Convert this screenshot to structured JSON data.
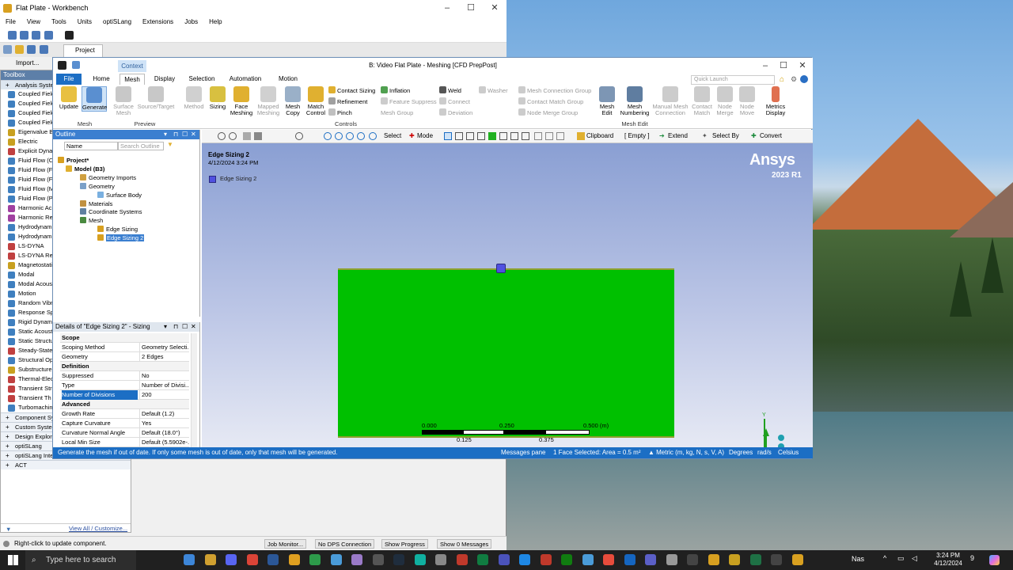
{
  "workbench": {
    "title": "Flat Plate - Workbench",
    "menu": [
      "File",
      "View",
      "Tools",
      "Units",
      "optiSLang",
      "Extensions",
      "Jobs",
      "Help"
    ],
    "import_label": "Import...",
    "project_tab": "Project",
    "toolbox_title": "Toolbox",
    "analysis_group": "Analysis Systems",
    "toolbox_items": [
      {
        "label": "Coupled Field",
        "color": "#3f7fbf"
      },
      {
        "label": "Coupled Field",
        "color": "#3f7fbf"
      },
      {
        "label": "Coupled Field",
        "color": "#3f7fbf"
      },
      {
        "label": "Coupled Field",
        "color": "#3f7fbf"
      },
      {
        "label": "Eigenvalue B",
        "color": "#c8a020"
      },
      {
        "label": "Electric",
        "color": "#c8a020"
      },
      {
        "label": "Explicit Dyna",
        "color": "#c04040"
      },
      {
        "label": "Fluid Flow (C",
        "color": "#3f7fbf"
      },
      {
        "label": "Fluid Flow (F",
        "color": "#3f7fbf"
      },
      {
        "label": "Fluid Flow (F",
        "color": "#3f7fbf"
      },
      {
        "label": "Fluid Flow (M",
        "color": "#3f7fbf"
      },
      {
        "label": "Fluid Flow (P",
        "color": "#3f7fbf"
      },
      {
        "label": "Harmonic Ac",
        "color": "#a040a0"
      },
      {
        "label": "Harmonic Re",
        "color": "#a040a0"
      },
      {
        "label": "Hydrodynam",
        "color": "#3f7fbf"
      },
      {
        "label": "Hydrodynam",
        "color": "#3f7fbf"
      },
      {
        "label": "LS-DYNA",
        "color": "#c04040"
      },
      {
        "label": "LS-DYNA Res",
        "color": "#c04040"
      },
      {
        "label": "Magnetostati",
        "color": "#c8a020"
      },
      {
        "label": "Modal",
        "color": "#3f7fbf"
      },
      {
        "label": "Modal Acous",
        "color": "#3f7fbf"
      },
      {
        "label": "Motion",
        "color": "#3f7fbf"
      },
      {
        "label": "Random Vibr",
        "color": "#3f7fbf"
      },
      {
        "label": "Response Sp",
        "color": "#3f7fbf"
      },
      {
        "label": "Rigid Dynam",
        "color": "#3f7fbf"
      },
      {
        "label": "Static Acoust",
        "color": "#3f7fbf"
      },
      {
        "label": "Static Structu",
        "color": "#3f7fbf"
      },
      {
        "label": "Steady-State",
        "color": "#c04040"
      },
      {
        "label": "Structural Op",
        "color": "#3f7fbf"
      },
      {
        "label": "Substructure",
        "color": "#c8a020"
      },
      {
        "label": "Thermal-Elec",
        "color": "#c04040"
      },
      {
        "label": "Transient Str",
        "color": "#c04040"
      },
      {
        "label": "Transient Th",
        "color": "#c04040"
      },
      {
        "label": "Turbomachin",
        "color": "#3f7fbf"
      }
    ],
    "toolbox_groups": [
      "Component Sy",
      "Custom Syste",
      "Design Explor",
      "optiSLang",
      "optiSLang Integrations",
      "ACT"
    ],
    "view_all": "View All / Customize...",
    "status": "Right-click to update component.",
    "status_buttons": [
      "Job Monitor...",
      "No DPS Connection",
      "Show Progress",
      "Show 0 Messages"
    ]
  },
  "mechanical": {
    "title": "B: Video Flat Plate - Meshing [CFD PrepPost]",
    "context_tab": "Context",
    "tabs": [
      "File",
      "Home",
      "Mesh",
      "Display",
      "Selection",
      "Automation",
      "Motion"
    ],
    "quick_launch": "Quick Launch",
    "ribbon": {
      "update": "Update",
      "generate": "Generate",
      "surface_mesh": "Surface Mesh",
      "source_target": "Source/Target",
      "method": "Method",
      "sizing": "Sizing",
      "face_meshing": "Face Meshing",
      "mapped_meshing": "Mapped Meshing",
      "mesh_copy": "Mesh Copy",
      "match_control": "Match Control",
      "contact_sizing": "Contact Sizing",
      "refinement": "Refinement",
      "pinch": "Pinch",
      "inflation": "Inflation",
      "feature_suppress": "Feature Suppress",
      "mesh_group": "Mesh Group",
      "weld": "Weld",
      "connect": "Connect",
      "deviation": "Deviation",
      "washer": "Washer",
      "mesh_connection_group": "Mesh Connection Group",
      "contact_match_group": "Contact Match Group",
      "node_merge_group": "Node Merge Group",
      "mesh_edit": "Mesh Edit",
      "mesh_numbering": "Mesh Numbering",
      "manual_mesh_connection": "Manual Mesh Connection",
      "contact_match": "Contact Match",
      "node_merge": "Node Merge",
      "node_move": "Node Move",
      "metrics_display": "Metrics Display",
      "group_mesh": "Mesh",
      "group_preview": "Preview",
      "group_controls": "Controls",
      "group_mesh_edit": "Mesh Edit"
    },
    "viewbar": {
      "select": "Select",
      "mode": "Mode",
      "clipboard": "Clipboard",
      "empty": "[ Empty ]",
      "extend": "Extend",
      "select_by": "Select By",
      "convert": "Convert"
    },
    "outline": {
      "title": "Outline",
      "name_label": "Name",
      "search_placeholder": "Search Outline",
      "tree": [
        "Project*",
        "Model (B3)",
        "Geometry Imports",
        "Geometry",
        "Surface Body",
        "Materials",
        "Coordinate Systems",
        "Mesh",
        "Edge Sizing",
        "Edge Sizing 2"
      ]
    },
    "details": {
      "title": "Details of \"Edge Sizing 2\" - Sizing",
      "rows": [
        {
          "k": "Scope",
          "v": "",
          "head": true
        },
        {
          "k": "Scoping Method",
          "v": "Geometry Selecti..."
        },
        {
          "k": "Geometry",
          "v": "2 Edges"
        },
        {
          "k": "Definition",
          "v": "",
          "head": true
        },
        {
          "k": "Suppressed",
          "v": "No"
        },
        {
          "k": "Type",
          "v": "Number of Divisi..."
        },
        {
          "k": "Number of Divisions",
          "v": "200",
          "highlight": true
        },
        {
          "k": "Advanced",
          "v": "",
          "head": true
        },
        {
          "k": "Growth Rate",
          "v": "Default (1.2)"
        },
        {
          "k": "Capture Curvature",
          "v": "Yes"
        },
        {
          "k": "Curvature Normal Angle",
          "v": "Default (18.0°)"
        },
        {
          "k": "Local Min Size",
          "v": "Default (5.5902e-..."
        }
      ]
    },
    "viewport": {
      "label_title": "Edge Sizing 2",
      "label_date": "4/12/2024 3:24 PM",
      "legend": "Edge Sizing 2",
      "brand": "Ansys",
      "version": "2023 R1",
      "scale_top": [
        "0.000",
        "0.250",
        "0.500 (m)"
      ],
      "scale_bottom": [
        "0.125",
        "0.375"
      ],
      "axis_x": "X",
      "axis_y": "Y",
      "plate_color": "#00c000",
      "legend_color": "#5050e0"
    },
    "status": {
      "hint": "Generate the mesh if out of date. If only some mesh is out of date, only that mesh will be generated.",
      "messages": "Messages pane",
      "selection": "1 Face Selected: Area = 0.5 m²",
      "units": "▲ Metric (m, kg, N, s, V, A)",
      "angle": "Degrees",
      "rate": "rad/s",
      "temp": "Celsius"
    }
  },
  "taskbar": {
    "search_placeholder": "Type here to search",
    "weather": "Nas",
    "time": "3:24 PM",
    "date": "4/12/2024",
    "notif": "9"
  }
}
